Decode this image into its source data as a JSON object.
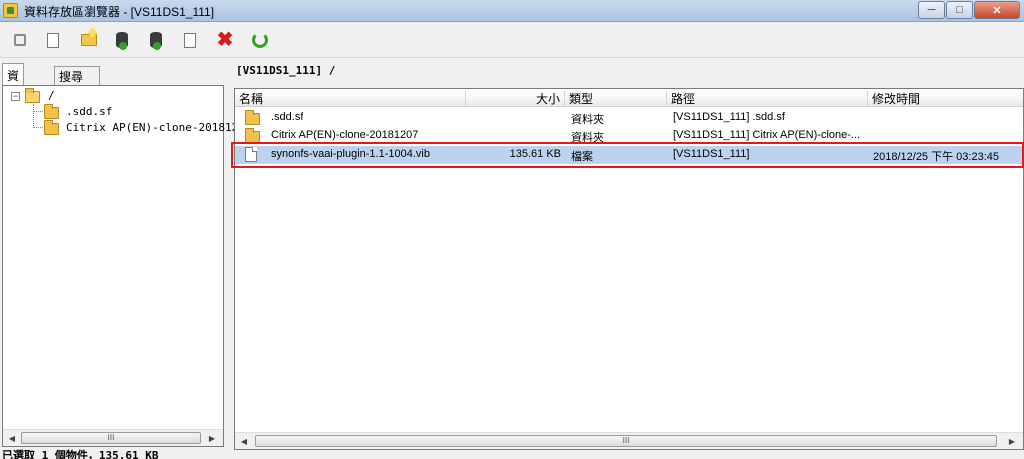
{
  "window": {
    "title": "資料存放區瀏覽器 - [VS11DS1_111]",
    "controls": [
      "minimize",
      "maximize",
      "close"
    ]
  },
  "toolbar": {
    "buttons": [
      {
        "name": "copy-icon"
      },
      {
        "name": "paste-icon"
      },
      {
        "name": "new-folder-icon"
      },
      {
        "name": "upload-icon"
      },
      {
        "name": "download-icon"
      },
      {
        "name": "move-icon"
      },
      {
        "name": "delete-icon"
      },
      {
        "name": "refresh-icon"
      }
    ]
  },
  "left": {
    "tabs": [
      "資料夾",
      "搜尋"
    ],
    "tree": [
      {
        "label": "/",
        "level": 0
      },
      {
        "label": ".sdd.sf",
        "level": 1
      },
      {
        "label": "Citrix AP(EN)-clone-201812",
        "level": 1
      }
    ],
    "scroll_thumb": "III"
  },
  "right": {
    "path": "[VS11DS1_111] /",
    "columns": [
      "名稱",
      "大小",
      "類型",
      "路徑",
      "修改時間"
    ],
    "rows": [
      {
        "name": ".sdd.sf",
        "size": "",
        "type": "資料夾",
        "path": "[VS11DS1_111] .sdd.sf",
        "modified": "",
        "icon": "folder-icon",
        "selected": false
      },
      {
        "name": "Citrix AP(EN)-clone-20181207",
        "size": "",
        "type": "資料夾",
        "path": "[VS11DS1_111] Citrix AP(EN)-clone-...",
        "modified": "",
        "icon": "folder-icon",
        "selected": false
      },
      {
        "name": "synonfs-vaai-plugin-1.1-1004.vib",
        "size": "135.61 KB",
        "type": "檔案",
        "path": "[VS11DS1_111]",
        "modified": "2018/12/25 下午 03:23:45",
        "icon": "file-icon",
        "selected": true
      }
    ],
    "scroll_thumb": "III"
  },
  "status": {
    "text": "已選取 1 個物件，135.61 KB"
  },
  "colors": {
    "selection": "#bcd3ee",
    "highlight": "#e11b1b",
    "folder": "#f2c14b"
  }
}
